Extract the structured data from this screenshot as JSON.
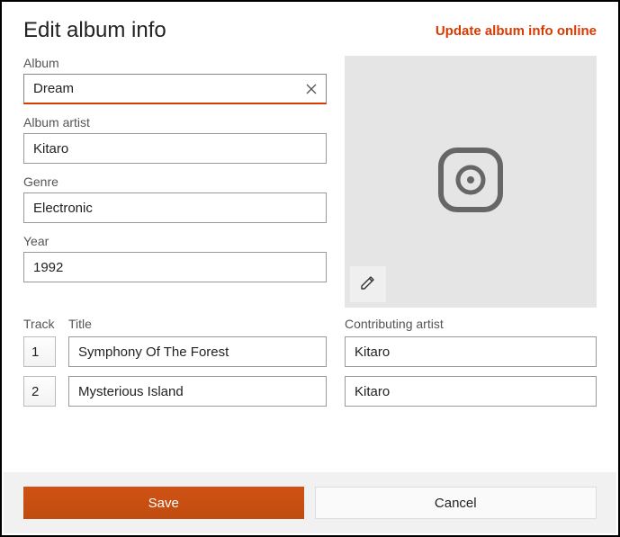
{
  "header": {
    "title": "Edit album info",
    "update_link": "Update album info online"
  },
  "labels": {
    "album": "Album",
    "album_artist": "Album artist",
    "genre": "Genre",
    "year": "Year",
    "track": "Track",
    "title": "Title",
    "contributing_artist": "Contributing artist"
  },
  "fields": {
    "album": "Dream",
    "album_artist": "Kitaro",
    "genre": "Electronic",
    "year": "1992"
  },
  "tracks": [
    {
      "num": "1",
      "title": "Symphony Of The Forest",
      "contrib": "Kitaro"
    },
    {
      "num": "2",
      "title": "Mysterious Island",
      "contrib": "Kitaro"
    }
  ],
  "footer": {
    "save": "Save",
    "cancel": "Cancel"
  },
  "colors": {
    "accent": "#d83b01",
    "save_button": "#ca5010"
  }
}
